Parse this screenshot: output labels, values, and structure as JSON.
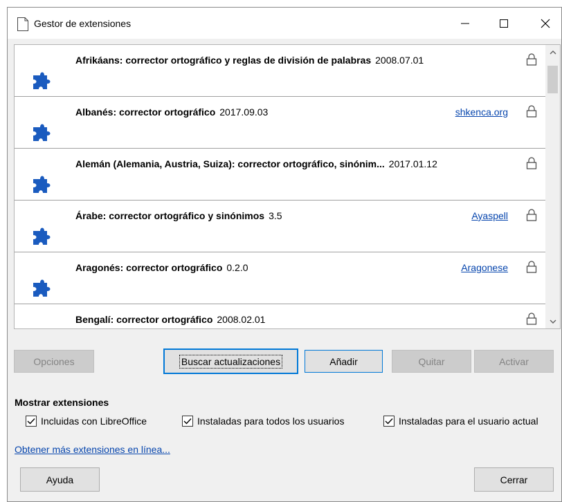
{
  "window": {
    "title": "Gestor de extensiones",
    "controls": {
      "minimize": "—",
      "maximize": "☐",
      "close": "✕"
    }
  },
  "extensions": [
    {
      "name": "Afrikáans: corrector ortográfico y reglas de división de palabras",
      "version": "2008.07.01",
      "link": ""
    },
    {
      "name": "Albanés: corrector ortográfico",
      "version": "2017.09.03",
      "link": "shkenca.org"
    },
    {
      "name": "Alemán (Alemania, Austria, Suiza): corrector ortográfico, sinónim...",
      "version": "2017.01.12",
      "link": ""
    },
    {
      "name": "Árabe: corrector ortográfico y sinónimos",
      "version": "3.5",
      "link": "Ayaspell"
    },
    {
      "name": "Aragonés: corrector ortográfico",
      "version": "0.2.0",
      "link": "Aragonese"
    },
    {
      "name": "Bengalí: corrector ortográfico",
      "version": "2008.02.01",
      "link": ""
    }
  ],
  "buttons": {
    "options": "Opciones",
    "check_updates": "Buscar actualizaciones",
    "add": "Añadir",
    "remove": "Quitar",
    "enable": "Activar",
    "help": "Ayuda",
    "close": "Cerrar"
  },
  "show_extensions": {
    "title": "Mostrar extensiones",
    "options": [
      {
        "label": "Incluidas con LibreOffice",
        "checked": true
      },
      {
        "label": "Instaladas para todos los usuarios",
        "checked": true
      },
      {
        "label": "Instaladas para el usuario actual",
        "checked": true
      }
    ]
  },
  "more_extensions_link": "Obtener más extensiones en línea...",
  "colors": {
    "accent": "#0078d7",
    "link": "#0645ad",
    "puzzle": "#1a5bbf"
  }
}
